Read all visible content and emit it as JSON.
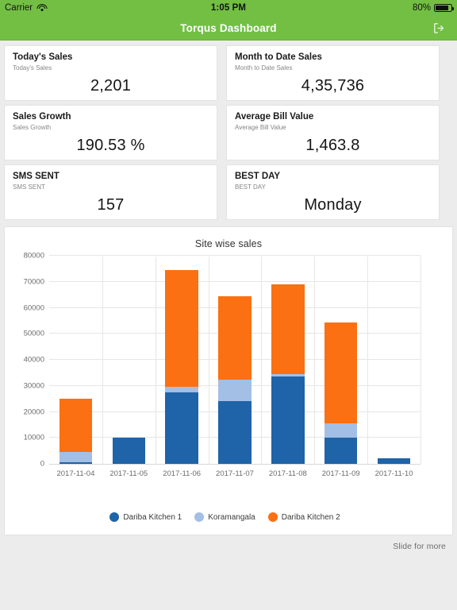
{
  "status_bar": {
    "carrier": "Carrier",
    "wifi_icon": "wifi-icon",
    "time": "1:05 PM",
    "battery_percent": "80%",
    "battery_icon": "battery-icon"
  },
  "nav": {
    "title": "Torqus Dashboard",
    "logout_icon": "logout-icon"
  },
  "colors": {
    "brand_green": "#72BF44",
    "series_dark_blue": "#1F63A8",
    "series_light_blue": "#A3BFE5",
    "series_orange": "#FB7013",
    "page_background": "#ECECEC",
    "card_background": "#FFFFFF"
  },
  "cards": [
    {
      "title": "Today's Sales",
      "subtitle": "Today's Sales",
      "value": "2,201"
    },
    {
      "title": "Month to Date Sales",
      "subtitle": "Month to Date Sales",
      "value": "4,35,736"
    },
    {
      "title": "Sales Growth",
      "subtitle": "Sales Growth",
      "value": "190.53 %"
    },
    {
      "title": "Average Bill Value",
      "subtitle": "Average Bill Value",
      "value": "1,463.8"
    },
    {
      "title": "SMS SENT",
      "subtitle": "SMS SENT",
      "value": "157"
    },
    {
      "title": "BEST DAY",
      "subtitle": "BEST DAY",
      "value": "Monday"
    }
  ],
  "chart_data": {
    "type": "bar",
    "stacked": true,
    "title": "Site wise sales",
    "xlabel": "",
    "ylabel": "",
    "ylim": [
      0,
      80000
    ],
    "yticks": [
      0,
      10000,
      20000,
      30000,
      40000,
      50000,
      60000,
      70000,
      80000
    ],
    "grid": true,
    "legend_position": "bottom",
    "categories": [
      "2017-11-04",
      "2017-11-05",
      "2017-11-06",
      "2017-11-07",
      "2017-11-08",
      "2017-11-09",
      "2017-11-10"
    ],
    "series": [
      {
        "name": "Dariba Kitchen 1",
        "color": "#1F63A8",
        "values": [
          700,
          10000,
          27500,
          24200,
          33500,
          10000,
          2000
        ]
      },
      {
        "name": "Koramangala",
        "color": "#A3BFE5",
        "values": [
          3800,
          0,
          2000,
          8100,
          1000,
          5500,
          0
        ]
      },
      {
        "name": "Dariba Kitchen 2",
        "color": "#FB7013",
        "values": [
          20500,
          0,
          45000,
          32200,
          34500,
          39000,
          0
        ]
      }
    ],
    "totals": [
      25000,
      10000,
      74500,
      64500,
      69000,
      54500,
      2000
    ]
  },
  "footer": {
    "slide_hint": "Slide for more"
  }
}
